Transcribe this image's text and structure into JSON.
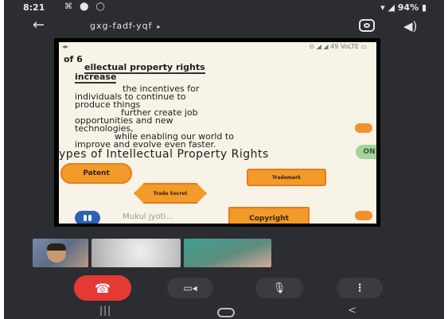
{
  "status_bar": {
    "time": "8:21",
    "notification_icons": "⌘ ⬤ ◯",
    "battery_text": "94%"
  },
  "header": {
    "back_icon": "←",
    "meeting_code": "gxg-fadf-yqf",
    "meeting_caret": "▸",
    "speaker_icon": "◀)"
  },
  "slide": {
    "status_left": "◂▸",
    "status_right": "⊙ ◢ ◢ 49 VoLTE ▭",
    "lines": [
      "of 6",
      "ellectual property rights",
      "increase",
      "the incentives for",
      "individuals to continue to",
      "produce    things",
      "further create job",
      "opportunities and new",
      "technologies,",
      "while enabling our world to",
      "improve and evolve even faster."
    ],
    "section_heading": "ypes of Intellectual Property Rights",
    "on_badge": "ON",
    "shapes": {
      "patent": "Patent",
      "trademark": "Trademark",
      "trade_secret": "Trade Secret",
      "copyright": "Copyright"
    },
    "presenter_name": "Mukul jyoti..."
  },
  "controls": {
    "end_call_icon": "☎",
    "camera_icon": "▭◂",
    "mic_icon": "🎙",
    "more_icon": "⋮"
  },
  "navbar": {
    "recent_icon": "|||",
    "back_icon": "<"
  },
  "colors": {
    "background": "#2c2d30",
    "slide_bg": "#f7f3e6",
    "shape_orange": "#f29a2a",
    "end_call_red": "#e53935",
    "presenter_blue": "#2b62b7",
    "on_badge_green": "#a4d49a"
  }
}
